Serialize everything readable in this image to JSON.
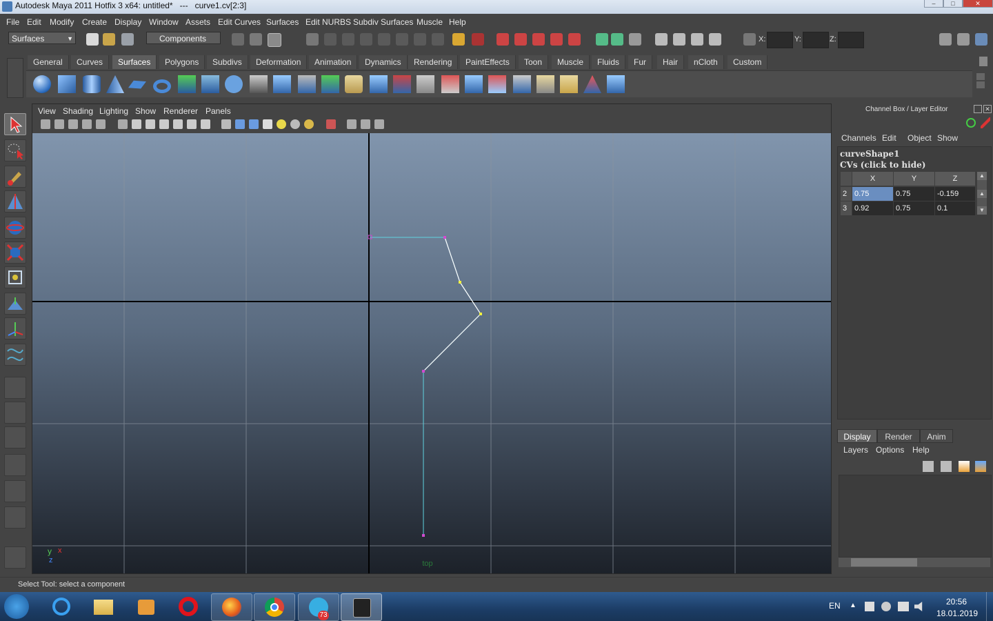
{
  "window": {
    "title": "Autodesk Maya 2011 Hotfix 3 x64: untitled*   ---   curve1.cv[2:3]",
    "controls": [
      "minimize-icon",
      "maximize-icon",
      "close-icon"
    ]
  },
  "menubar": {
    "items": [
      "File",
      "Edit",
      "Modify",
      "Create",
      "Display",
      "Window",
      "Assets",
      "Edit Curves",
      "Surfaces",
      "Edit NURBS",
      "Subdiv Surfaces",
      "Muscle",
      "Help"
    ]
  },
  "statusline": {
    "menuset": "Surfaces",
    "selection_mode": "Components",
    "coord_labels": [
      "X:",
      "Y:",
      "Z:"
    ]
  },
  "shelf": {
    "tabs": [
      "General",
      "Curves",
      "Surfaces",
      "Polygons",
      "Subdivs",
      "Deformation",
      "Animation",
      "Dynamics",
      "Rendering",
      "PaintEffects",
      "Toon",
      "Muscle",
      "Fluids",
      "Fur",
      "Hair",
      "nCloth",
      "Custom"
    ],
    "active_tab": "Surfaces",
    "icons": [
      "nurbs-sphere-icon",
      "nurbs-cube-icon",
      "nurbs-cylinder-icon",
      "nurbs-cone-icon",
      "nurbs-plane-icon",
      "nurbs-torus-icon",
      "revolve-icon",
      "loft-icon",
      "planar-icon",
      "extrude-icon",
      "birail-icon",
      "boundary-icon",
      "square-icon",
      "bevel-icon",
      "bevel-plus-icon",
      "project-curve-icon",
      "intersect-icon",
      "trim-icon",
      "untrim-icon",
      "attach-icon",
      "detach-icon",
      "align-icon",
      "open-close-icon",
      "insert-isoparm-icon",
      "extend-icon",
      "offset-icon",
      "rebuild-icon",
      "sculpt-icon",
      "surface-editing-icon"
    ]
  },
  "viewport": {
    "menus": [
      "View",
      "Shading",
      "Lighting",
      "Show",
      "Renderer",
      "Panels"
    ],
    "camera_label": "top",
    "axis_labels": {
      "y": "y",
      "x": "x",
      "z": "z"
    }
  },
  "channelbox": {
    "header": "Channel Box / Layer Editor",
    "menus": [
      "Channels",
      "Edit",
      "Object",
      "Show"
    ],
    "object_name": "curveShape1",
    "section_label": "CVs (click to hide)",
    "columns": [
      "X",
      "Y",
      "Z"
    ],
    "rows": [
      {
        "index": "2",
        "x": "0.75",
        "y": "0.75",
        "z": "-0.159"
      },
      {
        "index": "3",
        "x": "0.92",
        "y": "0.75",
        "z": "0.1"
      }
    ]
  },
  "layereditor": {
    "tabs": [
      "Display",
      "Render",
      "Anim"
    ],
    "active_tab": "Display",
    "menus": [
      "Layers",
      "Options",
      "Help"
    ]
  },
  "helpline": {
    "text": "Select Tool: select a component"
  },
  "taskbar": {
    "apps": [
      "start-orb-icon",
      "internet-explorer-icon",
      "file-explorer-icon",
      "media-player-icon",
      "opera-icon",
      "firefox-icon",
      "chrome-icon",
      "telegram-icon",
      "maya-icon"
    ],
    "telegram_badge": "73",
    "language": "EN",
    "time": "20:56",
    "date": "18.01.2019"
  }
}
